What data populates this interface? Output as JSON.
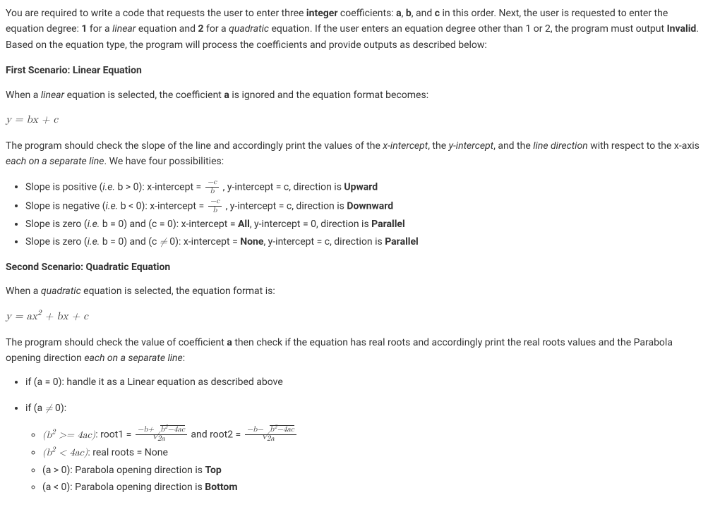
{
  "intro": {
    "part1": "You are required to write a code that requests the user to enter three ",
    "word_integer": "integer",
    "part2": " coefficients: ",
    "a": "a",
    "comma1": ", ",
    "b": "b",
    "comma2": ", and ",
    "c": "c",
    "part3": " in this order. Next, the user is requested to enter the equation degree: ",
    "one": "1",
    "part4": " for a ",
    "linear": "linear",
    "part5": " equation and ",
    "two": "2",
    "part6": " for a ",
    "quadratic": "quadratic",
    "part7": " equation. If the user enters an equation degree other than 1 or 2, the program must output ",
    "invalid": "Invalid",
    "part8": ". Based on the equation type, the program will process the coefficients and provide outputs as described below:"
  },
  "scenario1": {
    "heading": "First Scenario: Linear Equation",
    "p1a": "When a ",
    "p1_linear": "linear",
    "p1b": " equation is selected, the coefficient ",
    "p1_a": "a",
    "p1c": " is ignored and the equation format becomes:",
    "eq": "y = bx + c",
    "p2a": "The program should check the slope of the line and accordingly print the values of the ",
    "p2_xint": "x-intercept",
    "p2b": ", the ",
    "p2_yint": "y-intercept",
    "p2c": ", and the ",
    "p2_dir": "line direction",
    "p2d": " with respect to the x-axis ",
    "p2_each": "each on a separate line",
    "p2e": ". We have four possibilities:",
    "bullets": {
      "b1": {
        "t1": "Slope is positive (",
        "ie": "i.e.",
        "t2": " b > 0): x-intercept = ",
        "frac_num": "−c",
        "frac_den": "b",
        "t3": " , y-intercept = c, direction is ",
        "dir": "Upward"
      },
      "b2": {
        "t1": "Slope is negative (",
        "ie": "i.e.",
        "t2": " b < 0): x-intercept = ",
        "frac_num": "−c",
        "frac_den": "b",
        "t3": " , y-intercept = c, direction is ",
        "dir": "Downward"
      },
      "b3": {
        "t1": "Slope is zero (",
        "ie": "i.e.",
        "t2": " b = 0) and (c = 0): x-intercept = ",
        "all": "All",
        "t3": ", y-intercept = 0, direction is ",
        "dir": "Parallel"
      },
      "b4": {
        "t1": "Slope is zero (",
        "ie": "i.e.",
        "t2": " b = 0) and (c ",
        "neq": "≠",
        "t2b": " 0): x-intercept = ",
        "none": "None",
        "t3": ", y-intercept = c, direction is ",
        "dir": "Parallel"
      }
    }
  },
  "scenario2": {
    "heading": "Second Scenario: Quadratic Equation",
    "p1a": "When a ",
    "p1_quad": "quadratic",
    "p1b": " equation is selected, the equation format is:",
    "eq": "y = ax",
    "eq_sup": "2",
    "eq2": " + bx + c",
    "p2a": "The program should check the value of coefficient ",
    "p2_a": "a",
    "p2b": " then check if the equation has real roots and accordingly print the real roots values and the Parabola opening direction ",
    "p2_each": "each on a separate line",
    "p2c": ":",
    "outer": {
      "o1": "if (a = 0): handle it as a Linear equation as described above",
      "o2a": "if (a ",
      "o2_neq": "≠",
      "o2b": " 0):"
    },
    "inner": {
      "i1": {
        "cond_open": "(b",
        "cond_sup": "2",
        "cond_rest": " >= 4ac)",
        "label1": ": root1 = ",
        "num1_a": "−b+",
        "num1_sqrt_b": "b",
        "num1_sqrt_sup": "2",
        "num1_sqrt_rest": "−4ac",
        "den": "2a",
        "mid": " and root2 = ",
        "num2_a": "−b−",
        "num2_sqrt_b": "b",
        "num2_sqrt_sup": "2",
        "num2_sqrt_rest": "−4ac"
      },
      "i2": {
        "cond_open": "(b",
        "cond_sup": "2",
        "cond_rest": " < 4ac)",
        "label": ": real roots = None"
      },
      "i3": {
        "text": "(a > 0): Parabola opening direction is ",
        "dir": "Top"
      },
      "i4": {
        "text": "(a < 0): Parabola opening direction is ",
        "dir": "Bottom"
      }
    }
  }
}
